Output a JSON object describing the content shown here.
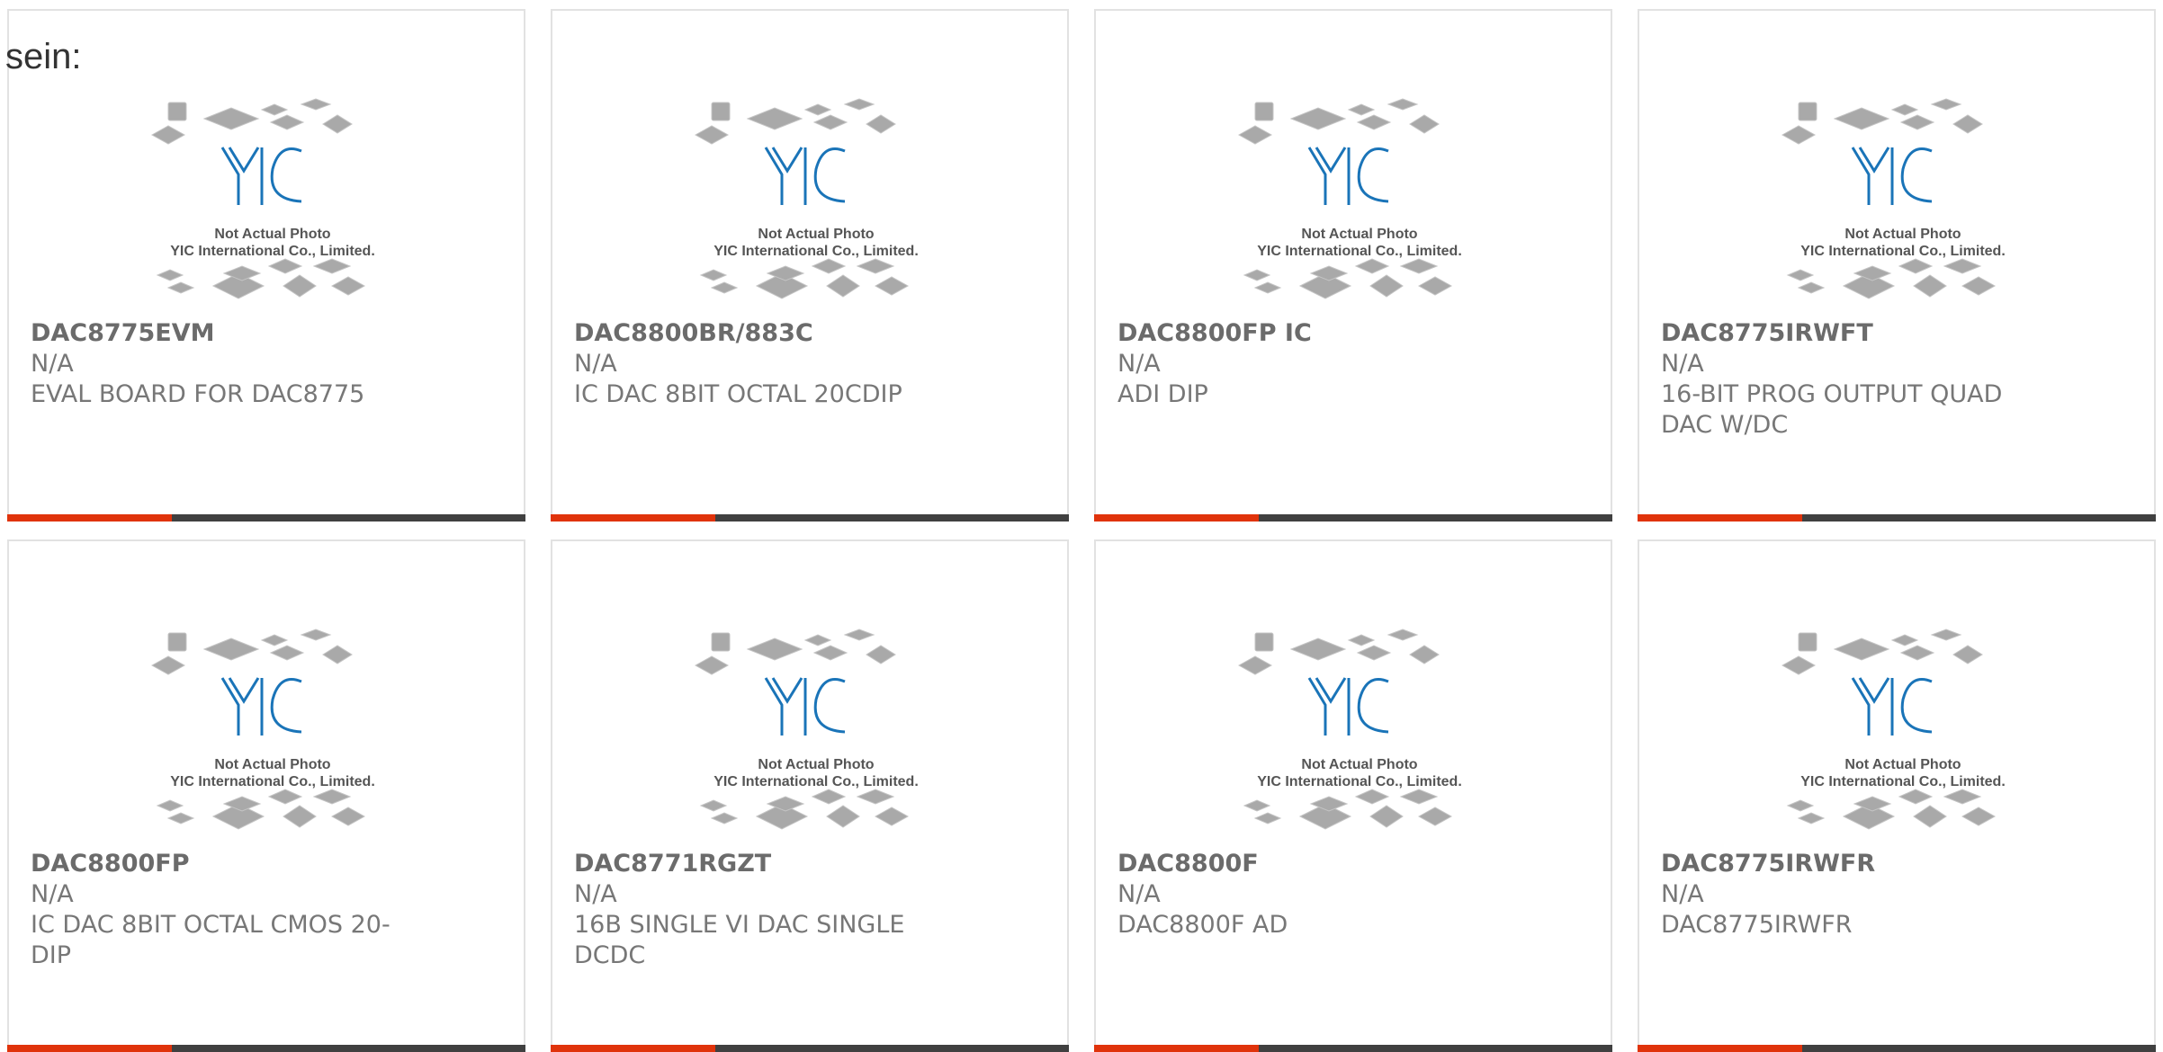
{
  "intro_text": "sein:",
  "placeholder_image": {
    "logo_text": "YIC",
    "caption_line1": "Not Actual Photo",
    "caption_line2": "YIC International Co., Limited."
  },
  "colors": {
    "accent": "#e0330b",
    "bar_dark": "#404040",
    "logo_blue": "#1a74b8",
    "text_gray": "#777777"
  },
  "products": [
    {
      "part_number": "DAC8775EVM",
      "manufacturer": "N/A",
      "description": "EVAL BOARD FOR DAC8775"
    },
    {
      "part_number": "DAC8800BR/883C",
      "manufacturer": "N/A",
      "description": "IC DAC 8BIT OCTAL 20CDIP"
    },
    {
      "part_number": "DAC8800FP IC",
      "manufacturer": "N/A",
      "description": "ADI DIP"
    },
    {
      "part_number": "DAC8775IRWFT",
      "manufacturer": "N/A",
      "description": "16-BIT PROG OUTPUT QUAD DAC W/DC"
    },
    {
      "part_number": "DAC8800FP",
      "manufacturer": "N/A",
      "description": "IC DAC 8BIT OCTAL CMOS 20-DIP"
    },
    {
      "part_number": "DAC8771RGZT",
      "manufacturer": "N/A",
      "description": "16B SINGLE VI DAC SINGLE DCDC"
    },
    {
      "part_number": "DAC8800F",
      "manufacturer": "N/A",
      "description": "DAC8800F AD"
    },
    {
      "part_number": "DAC8775IRWFR",
      "manufacturer": "N/A",
      "description": "DAC8775IRWFR"
    }
  ]
}
